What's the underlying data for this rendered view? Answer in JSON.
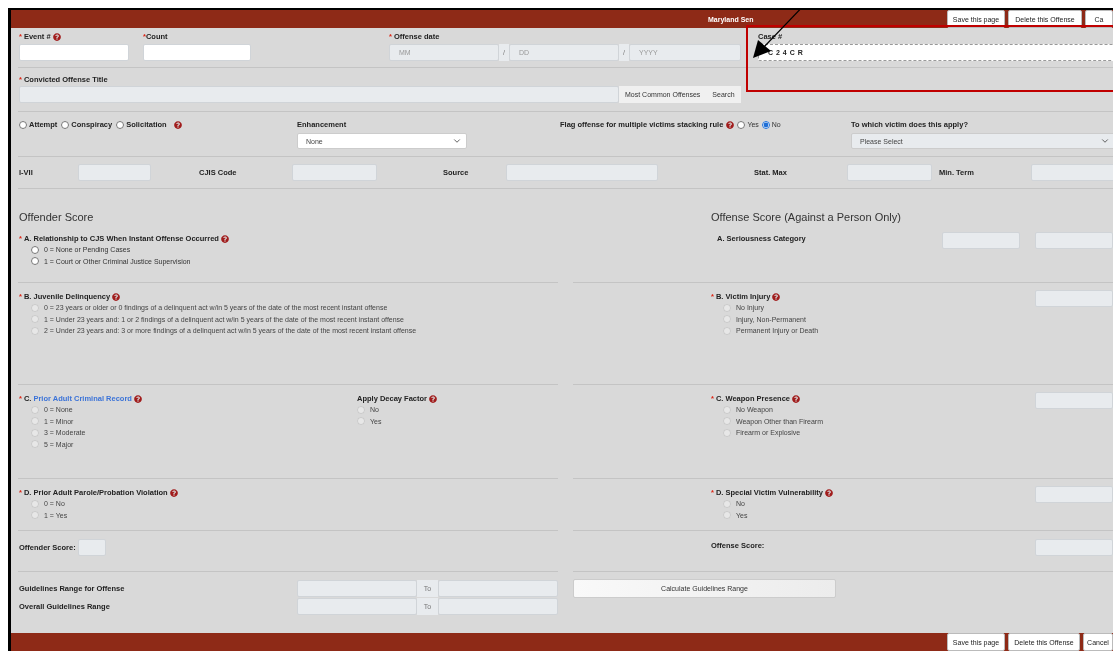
{
  "header": {
    "title": "Maryland Sen",
    "buttons": [
      "Save this page",
      "Delete this Offense",
      "Ca"
    ]
  },
  "top_fields": {
    "event": {
      "label": "Event #",
      "required_mark": "*",
      "help": true
    },
    "count": {
      "label": "Count",
      "required_mark": "*"
    },
    "offense_date": {
      "label": "Offense date",
      "required_mark": "*",
      "parts": [
        {
          "placeholder": "MM"
        },
        {
          "placeholder": "DD"
        },
        {
          "placeholder": "YYYY"
        }
      ],
      "separator": "/"
    },
    "case": {
      "label": "Case #",
      "value": "C 2 4 C R"
    }
  },
  "offense_title": {
    "label": "Convicted Offense Title",
    "required_mark": "*",
    "buttons": [
      "Most Common Offenses",
      "Search"
    ]
  },
  "offense_type": {
    "options": [
      {
        "label": "Attempt",
        "selected": false
      },
      {
        "label": "Conspiracy",
        "selected": false
      },
      {
        "label": "Solicitation",
        "selected": false
      }
    ],
    "help": true
  },
  "enhancement": {
    "label": "Enhancement",
    "value": "None"
  },
  "stacking_flag": {
    "label": "Flag offense for multiple victims stacking rule",
    "help": true,
    "options": [
      {
        "label": "Yes",
        "selected": false
      },
      {
        "label": "No",
        "selected": true
      }
    ]
  },
  "victim": {
    "label": "To which victim does this apply?",
    "value": "Please Select"
  },
  "codes": [
    {
      "label": "I-VII"
    },
    {
      "label": "CJIS Code"
    },
    {
      "label": "Source"
    },
    {
      "label": "Stat. Max"
    },
    {
      "label": "Min. Term"
    }
  ],
  "offender_score": {
    "title": "Offender Score",
    "questions": [
      {
        "label": "A. Relationship to CJS When Instant Offense Occurred",
        "required_mark": "*",
        "help": true,
        "disabled": false,
        "options": [
          {
            "label": "0 = None or Pending Cases",
            "selected": false
          },
          {
            "label": "1 = Court or Other Criminal Justice Supervision",
            "selected": false
          }
        ]
      },
      {
        "label": "B. Juvenile Delinquency",
        "required_mark": "*",
        "help": true,
        "disabled": true,
        "options": [
          {
            "label": "0 = 23 years or older or 0 findings of a delinquent act w/in 5 years of the date of the most recent instant offense",
            "selected": false
          },
          {
            "label": "1 = Under 23 years and: 1 or 2 findings of a delinquent act w/in 5 years of the date of the most recent instant offense",
            "selected": false
          },
          {
            "label": "2 = Under 23 years and: 3 or more findings of a delinquent act w/in 5 years of the date of the most recent instant offense",
            "selected": false
          }
        ]
      },
      {
        "label": "C.",
        "link": "Prior Adult Criminal Record",
        "required_mark": "*",
        "help": true,
        "disabled": true,
        "options": [
          {
            "label": "0 = None",
            "selected": false
          },
          {
            "label": "1 = Minor",
            "selected": false
          },
          {
            "label": "3 = Moderate",
            "selected": false
          },
          {
            "label": "5 = Major",
            "selected": false
          }
        ],
        "sub_question": {
          "label": "Apply Decay Factor",
          "help": true,
          "disabled": true,
          "options": [
            {
              "label": "No",
              "selected": false
            },
            {
              "label": "Yes",
              "selected": false
            }
          ]
        }
      },
      {
        "label": "D. Prior Adult Parole/Probation Violation",
        "required_mark": "*",
        "help": true,
        "disabled": true,
        "options": [
          {
            "label": "0 = No",
            "selected": false
          },
          {
            "label": "1 = Yes",
            "selected": false
          }
        ]
      }
    ],
    "total_label": "Offender Score:"
  },
  "offense_score": {
    "title": "Offense Score (Against a Person Only)",
    "questions": [
      {
        "label": "A. Seriousness Category",
        "boxes": [
          {
            "kind": "box"
          },
          {
            "kind": "box"
          }
        ]
      },
      {
        "label": "B. Victim Injury",
        "required_mark": "*",
        "help": true,
        "disabled": true,
        "options": [
          {
            "label": "No Injury",
            "selected": false
          },
          {
            "label": "Injury, Non-Permanent",
            "selected": false
          },
          {
            "label": "Permanent Injury or Death",
            "selected": false
          }
        ],
        "boxes": [
          {
            "kind": "box"
          }
        ]
      },
      {
        "label": "C. Weapon Presence",
        "required_mark": "*",
        "help": true,
        "disabled": true,
        "options": [
          {
            "label": "No Weapon",
            "selected": false
          },
          {
            "label": "Weapon Other than Firearm",
            "selected": false
          },
          {
            "label": "Firearm or Explosive",
            "selected": false
          }
        ],
        "boxes": [
          {
            "kind": "box"
          }
        ]
      },
      {
        "label": "D. Special Victim Vulnerability",
        "required_mark": "*",
        "help": true,
        "disabled": true,
        "options": [
          {
            "label": "No",
            "selected": false
          },
          {
            "label": "Yes",
            "selected": false
          }
        ],
        "boxes": [
          {
            "kind": "box"
          }
        ]
      }
    ],
    "total_label": "Offense Score:"
  },
  "ranges": [
    {
      "label": "Guidelines Range for Offense",
      "to": "To"
    },
    {
      "label": "Overall Guidelines Range",
      "to": "To"
    }
  ],
  "calculate_button": "Calculate Guidelines Range",
  "footer": {
    "buttons": [
      "Save this page",
      "Delete this Offense",
      "Cancel"
    ]
  }
}
